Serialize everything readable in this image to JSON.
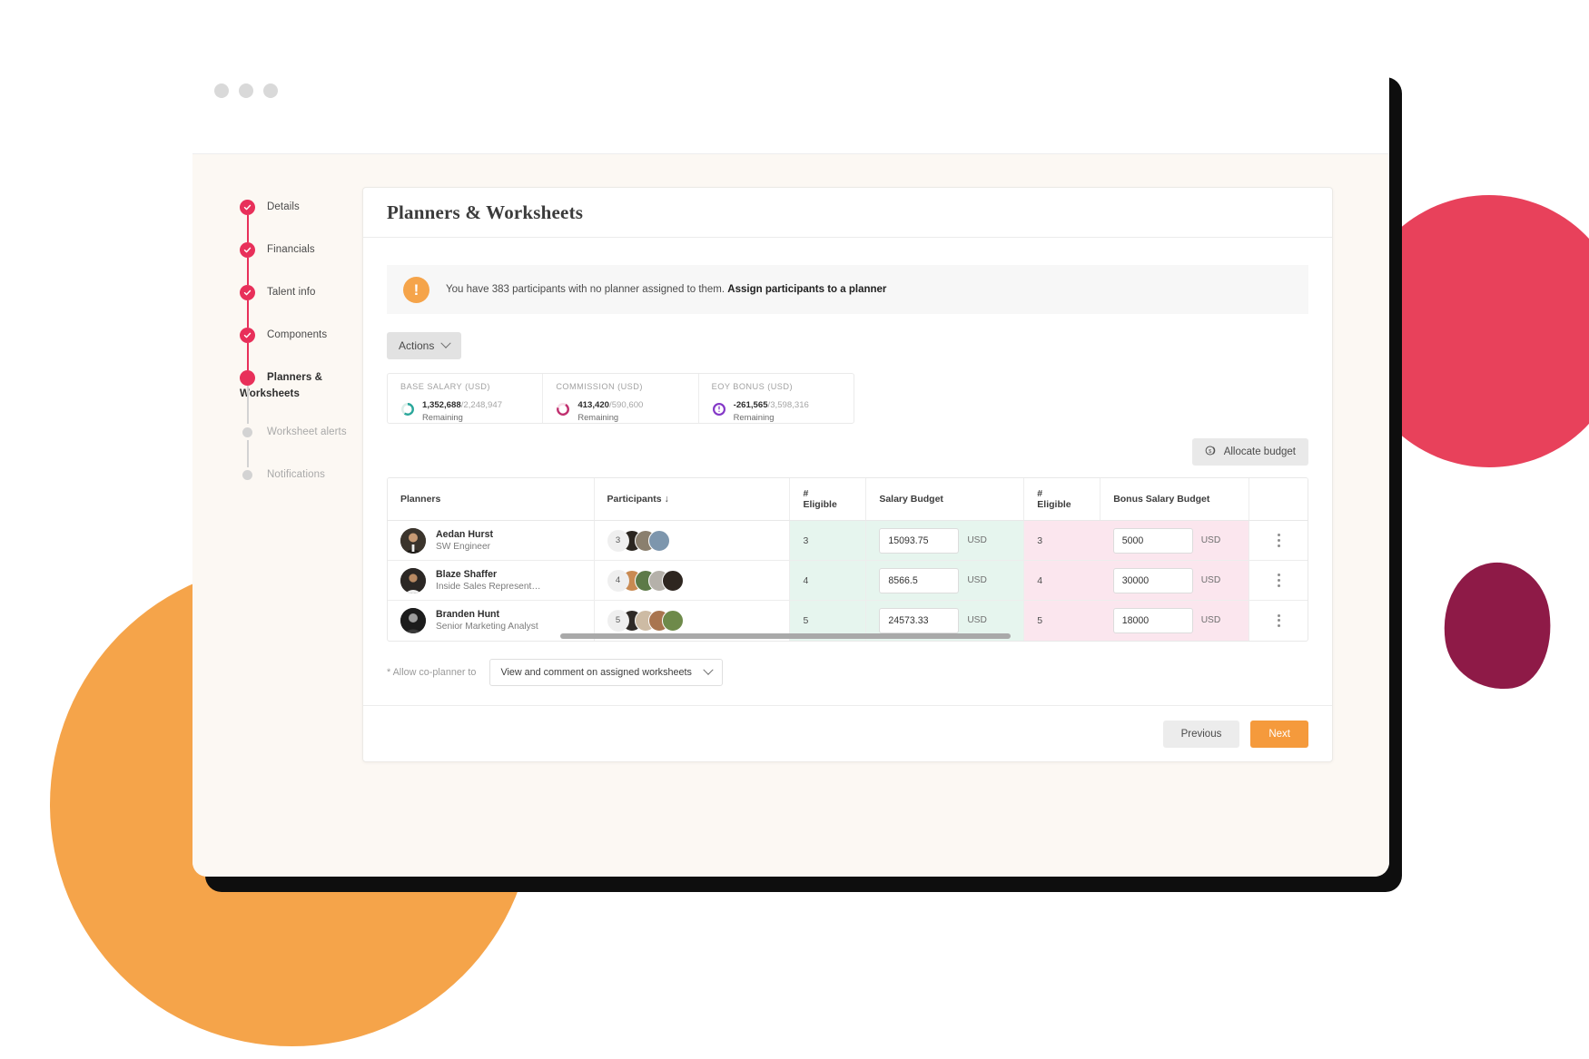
{
  "window": {
    "dots": 3
  },
  "stepper": {
    "items": [
      {
        "label": "Details",
        "state": "done"
      },
      {
        "label": "Financials",
        "state": "done"
      },
      {
        "label": "Talent info",
        "state": "done"
      },
      {
        "label": "Components",
        "state": "done"
      },
      {
        "label": "Planners & Worksheets",
        "state": "current"
      },
      {
        "label": "Worksheet alerts",
        "state": "pending"
      },
      {
        "label": "Notifications",
        "state": "pending"
      }
    ]
  },
  "card": {
    "title": "Planners & Worksheets"
  },
  "alert": {
    "icon": "warning-icon",
    "text": "You have 383 participants with no planner assigned to them.",
    "link_text": "Assign participants to a planner",
    "participant_count": 383,
    "icon_color": "#f5a44a"
  },
  "toolbar": {
    "actions_label": "Actions",
    "allocate_label": "Allocate budget",
    "allocate_icon": "coin-icon"
  },
  "budgets": [
    {
      "title": "BASE SALARY",
      "currency": "(USD)",
      "remaining": "1,352,688",
      "total": "2,248,947",
      "sub": "Remaining",
      "color": "#2aa79b",
      "percent": 60
    },
    {
      "title": "COMMISSION",
      "currency": "(USD)",
      "remaining": "413,420",
      "total": "590,600",
      "sub": "Remaining",
      "color": "#c0306f",
      "percent": 70
    },
    {
      "title": "EOY BONUS",
      "currency": "(USD)",
      "remaining": "-261,565",
      "total": "3,598,316",
      "sub": "Remaining",
      "color": "#8438c7",
      "percent": 100
    }
  ],
  "table": {
    "columns": [
      {
        "label": "Planners",
        "sort": ""
      },
      {
        "label": "Participants",
        "sort": "↓"
      },
      {
        "label": "#\nEligible",
        "sort": ""
      },
      {
        "label": "Salary Budget",
        "sort": ""
      },
      {
        "label": "#\nEligible",
        "sort": ""
      },
      {
        "label": "Bonus Salary Budget",
        "sort": ""
      },
      {
        "label": "",
        "sort": ""
      }
    ],
    "headers": {
      "planners": "Planners",
      "participants": "Participants",
      "participants_sort": "↓",
      "eligible1_line1": "#",
      "eligible1_line2": "Eligible",
      "salary_budget": "Salary Budget",
      "eligible2_line1": "#",
      "eligible2_line2": "Eligible",
      "bonus_salary_budget": "Bonus Salary Budget"
    },
    "rows": [
      {
        "name": "Aedan Hurst",
        "role": "SW Engineer",
        "participants": "3",
        "eligible1": "3",
        "salary_budget": "15093.75",
        "currency1": "USD",
        "eligible2": "3",
        "bonus_budget": "5000",
        "currency2": "USD",
        "avatar_color": "#4a4038",
        "stack_colors": [
          "#2b2620",
          "#8a7f6e",
          "#7d96ad",
          "#5d5346"
        ]
      },
      {
        "name": "Blaze Shaffer",
        "role": "Inside Sales Representati…",
        "participants": "4",
        "eligible1": "4",
        "salary_budget": "8566.5",
        "currency1": "USD",
        "eligible2": "4",
        "bonus_budget": "30000",
        "currency2": "USD",
        "avatar_color": "#33302c",
        "stack_colors": [
          "#c98a52",
          "#5d7a48",
          "#b5b1aa",
          "#2e2620"
        ]
      },
      {
        "name": "Branden Hunt",
        "role": "Senior Marketing Analyst",
        "participants": "5",
        "eligible1": "5",
        "salary_budget": "24573.33",
        "currency1": "USD",
        "eligible2": "5",
        "bonus_budget": "18000",
        "currency2": "USD",
        "avatar_color": "#252525",
        "stack_colors": [
          "#2f2a26",
          "#cdbba4",
          "#a9754f",
          "#6e8a4a"
        ]
      }
    ]
  },
  "coplanner": {
    "label": "* Allow co-planner to",
    "value": "View and comment on assigned worksheets"
  },
  "footer": {
    "previous": "Previous",
    "next": "Next",
    "next_color": "#f59a3c"
  },
  "colors": {
    "accent_pink": "#e8305a",
    "orange": "#f5a44a",
    "deco_pink": "#e8415b",
    "deco_maroon": "#8e1a47",
    "deco_orange": "#f5a44a",
    "page_bg": "#fcf8f3"
  }
}
